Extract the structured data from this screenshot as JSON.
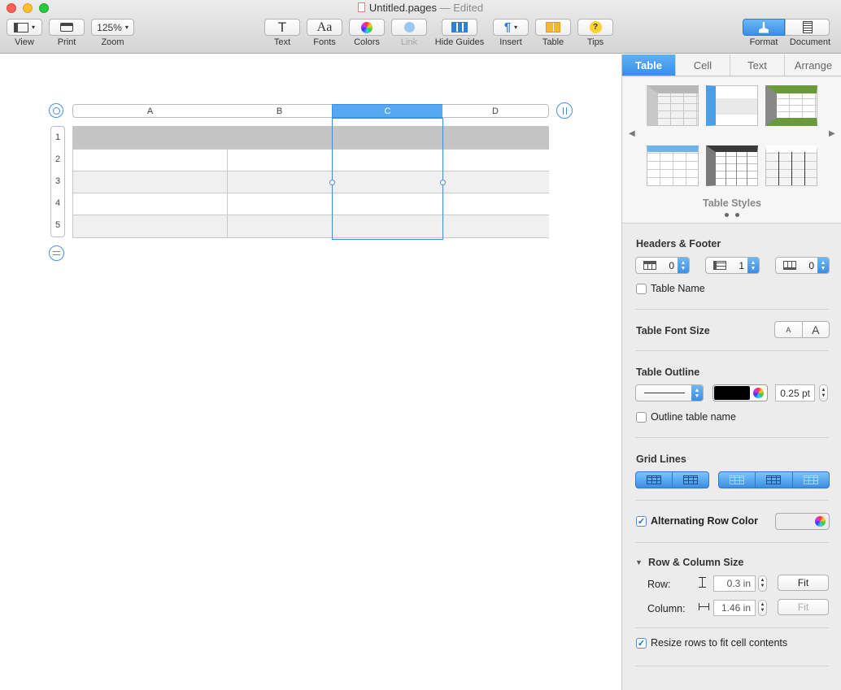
{
  "window": {
    "title": "Untitled.pages",
    "status": "Edited",
    "separator": "—"
  },
  "toolbar": {
    "zoom_value": "125%",
    "items": [
      {
        "label": "View"
      },
      {
        "label": "Print"
      },
      {
        "label": "Zoom"
      },
      {
        "label": "Text"
      },
      {
        "label": "Fonts"
      },
      {
        "label": "Colors"
      },
      {
        "label": "Link"
      },
      {
        "label": "Hide Guides"
      },
      {
        "label": "Insert"
      },
      {
        "label": "Table"
      },
      {
        "label": "Tips"
      },
      {
        "label": "Format"
      },
      {
        "label": "Document"
      }
    ],
    "text_glyph": "T",
    "fonts_glyph": "Aa",
    "tips_glyph": "?",
    "insert_glyph": "¶"
  },
  "table": {
    "columns": [
      "A",
      "B",
      "C",
      "D"
    ],
    "rows": [
      "1",
      "2",
      "3",
      "4",
      "5"
    ],
    "selected_column": "C"
  },
  "inspector": {
    "tabs": [
      {
        "label": "Table",
        "active": true
      },
      {
        "label": "Cell"
      },
      {
        "label": "Text"
      },
      {
        "label": "Arrange"
      }
    ],
    "table_styles_label": "Table Styles",
    "headers_footer": {
      "title": "Headers & Footer",
      "header_rows": "0",
      "header_columns": "1",
      "footer_rows": "0"
    },
    "table_name_label": "Table Name",
    "font_size": {
      "title": "Table Font Size",
      "smaller": "A",
      "larger": "A"
    },
    "outline": {
      "title": "Table Outline",
      "color": "#000000",
      "width": "0.25 pt",
      "outline_name_label": "Outline table name"
    },
    "grid_lines_title": "Grid Lines",
    "alternating": {
      "label": "Alternating Row Color",
      "checked": true
    },
    "row_col_size": {
      "title": "Row & Column Size",
      "row_label": "Row:",
      "row_value": "0.3 in",
      "column_label": "Column:",
      "column_value": "1.46 in",
      "fit_label": "Fit"
    },
    "resize_label": "Resize rows to fit cell contents",
    "checkmark": "✓"
  },
  "colors": {
    "accent": "#3a8ee6",
    "header_row": "#c4c4c4",
    "alt_row": "#f0f0f0"
  }
}
